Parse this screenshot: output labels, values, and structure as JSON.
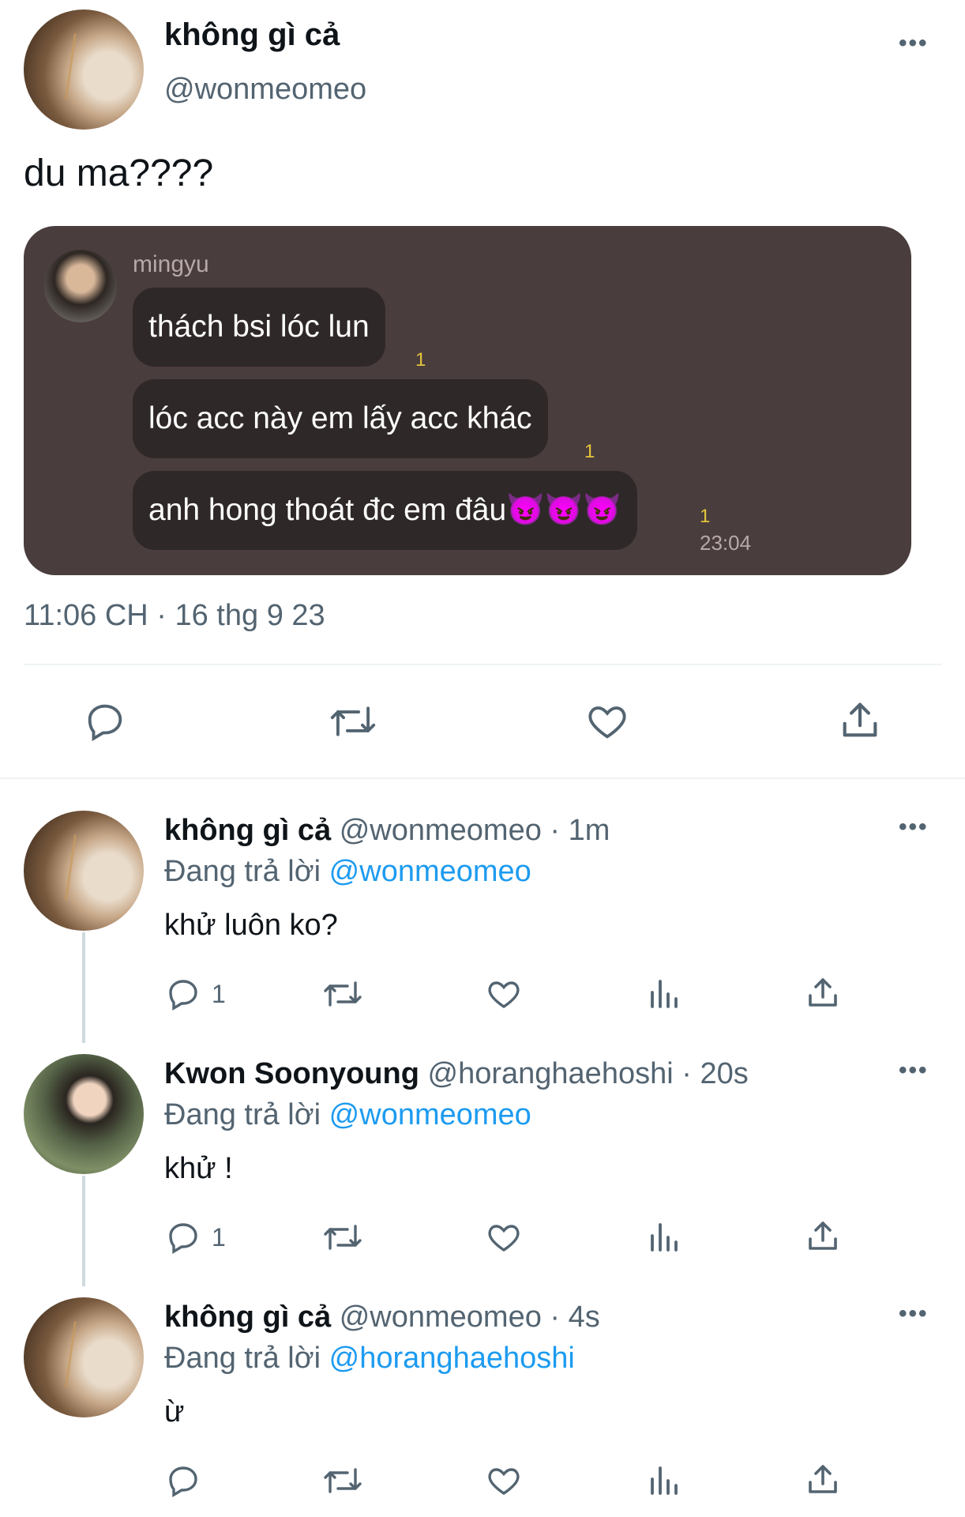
{
  "main_tweet": {
    "display_name": "không gì cả",
    "handle": "@wonmeomeo",
    "text": "du ma????",
    "timestamp": "11:06 CH · 16 thg 9 23",
    "screenshot": {
      "sender": "mingyu",
      "messages": [
        {
          "text": "thách bsi lóc lun",
          "count": "1"
        },
        {
          "text": "lóc acc này em lấy acc khác",
          "count": "1"
        },
        {
          "text": "anh hong thoát đc em đâu😈😈😈",
          "count": "1"
        }
      ],
      "time": "23:04"
    }
  },
  "replies": [
    {
      "display_name": "không gì cả",
      "handle": "@wonmeomeo",
      "time": "· 1m",
      "replying_label": "Đang trả lời",
      "replying_to": "@wonmeomeo",
      "text": "khử luôn ko?",
      "reply_count": "1"
    },
    {
      "display_name": "Kwon Soonyoung",
      "handle": "@horanghaehoshi",
      "time": "· 20s",
      "replying_label": "Đang trả lời",
      "replying_to": "@wonmeomeo",
      "text": "khử !",
      "reply_count": "1"
    },
    {
      "display_name": "không gì cả",
      "handle": "@wonmeomeo",
      "time": "· 4s",
      "replying_label": "Đang trả lời",
      "replying_to": "@horanghaehoshi",
      "text": "ừ",
      "reply_count": ""
    }
  ],
  "icons": {
    "more": "more-dots-icon",
    "reply": "reply-bubble-icon",
    "retweet": "retweet-icon",
    "like": "heart-icon",
    "views": "views-bar-chart-icon",
    "share": "share-upload-icon"
  },
  "colors": {
    "accent": "#1d9bf0",
    "secondary_text": "#536471",
    "chat_card": "#4a3d3d",
    "chat_bubble": "#2f2828",
    "read_count": "#e3c53a"
  }
}
